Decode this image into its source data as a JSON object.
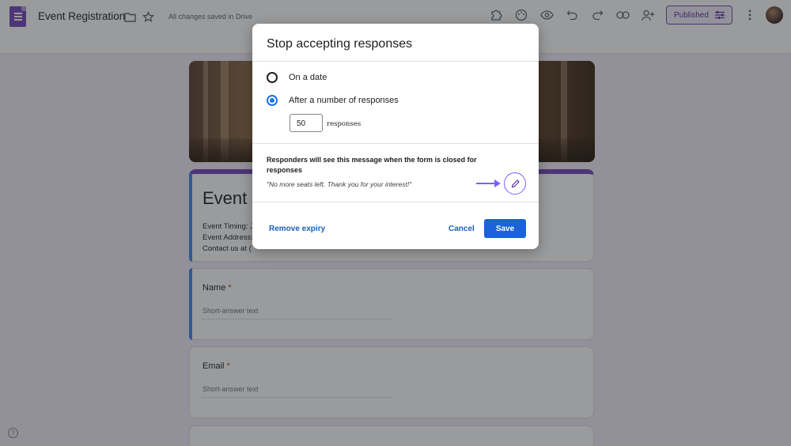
{
  "app": {
    "title": "Event Registration",
    "save_status": "All changes saved in Drive",
    "publish_label": "Published"
  },
  "form": {
    "title": "Event r",
    "description_lines": [
      "Event Timing: J",
      "Event Address:",
      "Contact us at ("
    ],
    "questions": [
      {
        "label": "Name",
        "required": "*",
        "placeholder": "Short-answer text"
      },
      {
        "label": "Email",
        "required": "*",
        "placeholder": "Short-answer text"
      }
    ]
  },
  "dialog": {
    "title": "Stop accepting responses",
    "option_date": "On a date",
    "option_count": "After a number of responses",
    "count_value": "50",
    "count_unit": "responses",
    "message_heading": "Responders will see this message when the form is closed for responses",
    "message_text": "\"No more seats left. Thank you for your interest!\"",
    "remove_label": "Remove expiry",
    "cancel_label": "Cancel",
    "save_label": "Save"
  },
  "colors": {
    "accent": "#7248b9",
    "primary_button": "#1a63d8",
    "highlight_arrow": "#7b61ff"
  },
  "icons": [
    "forms-logo-icon",
    "folder-icon",
    "star-icon",
    "addon-icon",
    "palette-icon",
    "preview-eye-icon",
    "undo-icon",
    "redo-icon",
    "link-icon",
    "add-collaborator-icon",
    "tune-icon",
    "more-vert-icon",
    "help-icon",
    "pencil-icon",
    "arrow-right-icon"
  ]
}
